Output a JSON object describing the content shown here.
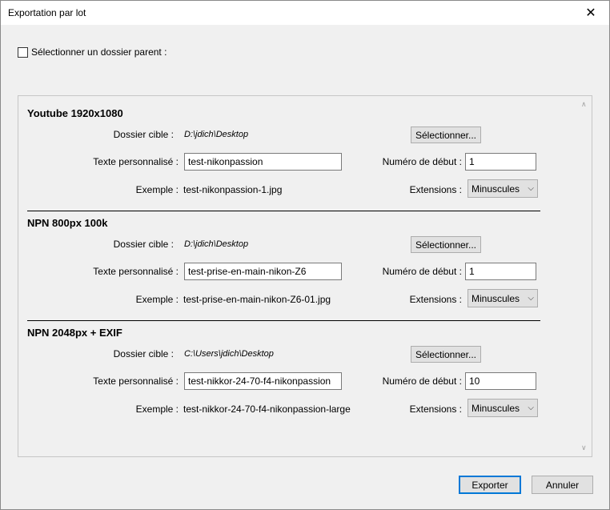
{
  "window": {
    "title": "Exportation par lot",
    "close_glyph": "✕"
  },
  "parent_folder": {
    "label": "Sélectionner un dossier parent :",
    "checked": false
  },
  "labels": {
    "target_folder": "Dossier cible :",
    "custom_text": "Texte personnalisé :",
    "example": "Exemple :",
    "start_number": "Numéro de début :",
    "extensions": "Extensions :",
    "select_button": "Sélectionner..."
  },
  "presets": [
    {
      "name": "Youtube 1920x1080",
      "target_folder": "D:\\jdich\\Desktop",
      "custom_text": "test-nikonpassion",
      "start_number": "1",
      "example": "test-nikonpassion-1.jpg",
      "extensions": "Minuscules"
    },
    {
      "name": "NPN 800px 100k",
      "target_folder": "D:\\jdich\\Desktop",
      "custom_text": "test-prise-en-main-nikon-Z6",
      "start_number": "1",
      "example": "test-prise-en-main-nikon-Z6-01.jpg",
      "extensions": "Minuscules"
    },
    {
      "name": "NPN 2048px + EXIF",
      "target_folder": "C:\\Users\\jdich\\Desktop",
      "custom_text": "test-nikkor-24-70-f4-nikonpassion",
      "start_number": "10",
      "example": "test-nikkor-24-70-f4-nikonpassion-large",
      "extensions": "Minuscules"
    }
  ],
  "footer": {
    "export_label": "Exporter",
    "cancel_label": "Annuler"
  },
  "icons": {
    "chevron": "⌵",
    "scroll_up": "∧",
    "scroll_down": "∨"
  }
}
